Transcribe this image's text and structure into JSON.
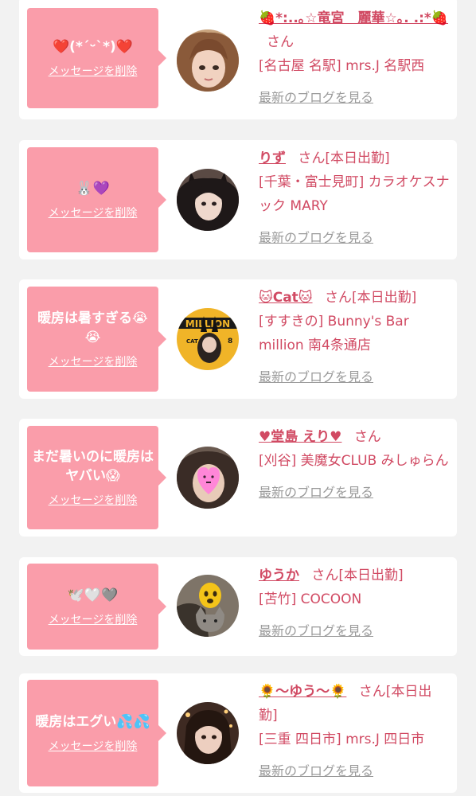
{
  "colors": {
    "page_bg": "#f2f2f2",
    "card_bg": "#ffffff",
    "bubble_bg": "#fa9daa",
    "accent": "#d14a63",
    "muted": "#9a9a9a"
  },
  "common": {
    "delete_label": "メッセージを削除",
    "blog_label": "最新のブログを見る",
    "san": "さん"
  },
  "items": [
    {
      "message": "❤️(*´ᵕ`*)❤️",
      "name": "🍓*:..｡☆竜宮　麗華☆｡. .:*🍓",
      "status": "",
      "shop": "[名古屋 名駅] mrs.J 名駅西"
    },
    {
      "message": "🐰💜",
      "name": "りず",
      "status": "[本日出勤]",
      "shop": "[千葉・富士見町] カラオケスナック MARY"
    },
    {
      "message": "暖房は暑すぎる😭😭",
      "name": "🐱Cat🐱",
      "status": "[本日出勤]",
      "shop": "[すすきの] Bunny's Bar million 南4条通店"
    },
    {
      "message": "まだ暑いのに暖房はヤバい😱",
      "name": "♥堂島 えり♥",
      "status": "",
      "shop": "[刈谷] 美魔女CLUB みしゅらん"
    },
    {
      "message": "🕊️🤍🩶",
      "name": "ゆうか",
      "status": "[本日出勤]",
      "shop": "[苫竹] COCOON"
    },
    {
      "message": "暖房はエグい💦💦",
      "name": "🌻〜ゆう〜🌻",
      "status": "[本日出勤]",
      "shop": "[三重 四日市] mrs.J 四日市"
    }
  ]
}
